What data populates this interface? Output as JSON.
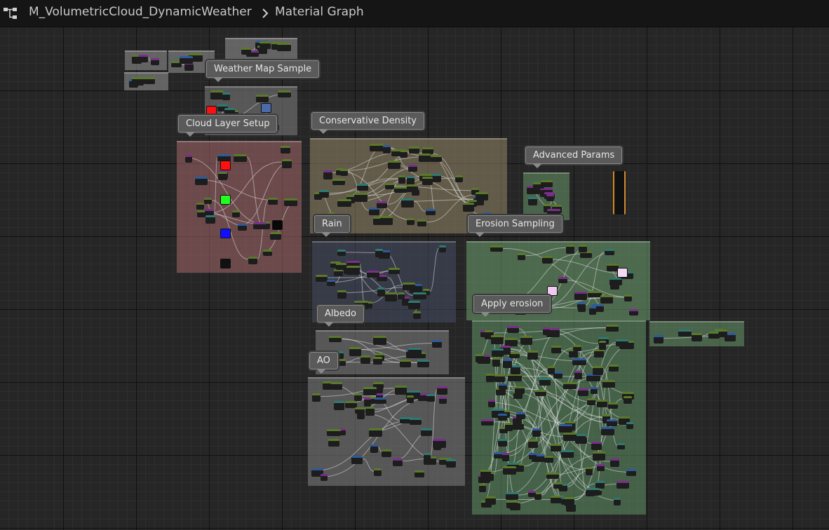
{
  "breadcrumb": {
    "asset": "M_VolumetricCloud_DynamicWeather",
    "graph": "Material Graph"
  },
  "comments": {
    "weather_map_sample": "Weather Map Sample",
    "cloud_layer_setup": "Cloud Layer Setup",
    "conservative_density": "Conservative Density",
    "advanced_params": "Advanced Params",
    "rain": "Rain",
    "erosion_sampling": "Erosion Sampling",
    "apply_erosion": "Apply erosion",
    "albedo": "Albedo",
    "ao": "AO"
  },
  "colors": {
    "cloud_layer_setup": "#8a5f60",
    "conservative_density": "#7d7460",
    "rain": "#3d4250",
    "erosion_sampling": "#5d8460",
    "albedo": "#676767",
    "node_green": "#5a7a2a",
    "node_purple": "#7b2e8a",
    "node_teal": "#2e7a72",
    "node_blue": "#2d5b9a",
    "node_red": "#a8243a"
  }
}
